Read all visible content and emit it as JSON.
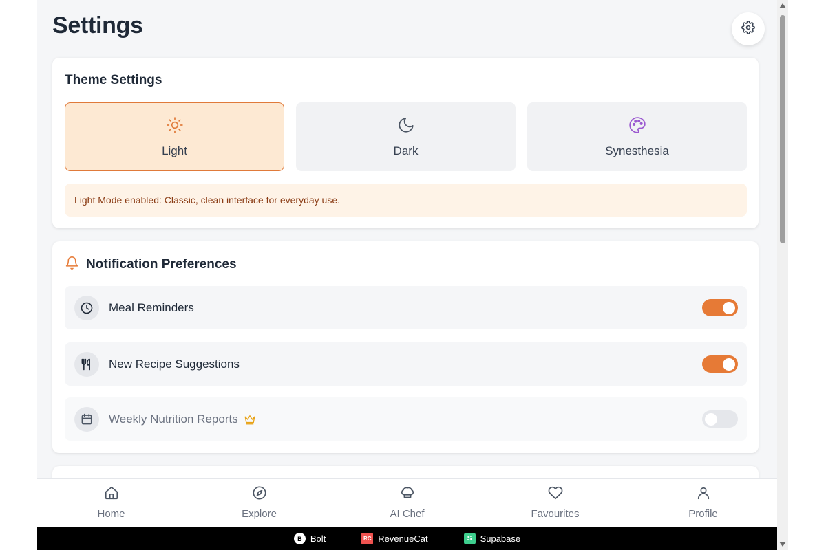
{
  "page": {
    "title": "Settings"
  },
  "header": {
    "settings_icon": "gear-icon"
  },
  "theme": {
    "heading": "Theme Settings",
    "options": [
      {
        "label": "Light",
        "icon": "sun-icon",
        "selected": true,
        "color": "#e07a3a"
      },
      {
        "label": "Dark",
        "icon": "moon-icon",
        "selected": false,
        "color": "#4b5563"
      },
      {
        "label": "Synesthesia",
        "icon": "palette-icon",
        "selected": false,
        "color": "#9b59d0"
      }
    ],
    "info": "Light Mode enabled: Classic, clean interface for everyday use."
  },
  "notifications": {
    "heading": "Notification Preferences",
    "heading_icon": "bell-icon",
    "items": [
      {
        "label": "Meal Reminders",
        "icon": "clock-icon",
        "enabled": true,
        "premium": false
      },
      {
        "label": "New Recipe Suggestions",
        "icon": "utensils-icon",
        "enabled": true,
        "premium": false
      },
      {
        "label": "Weekly Nutrition Reports",
        "icon": "calendar-icon",
        "enabled": false,
        "premium": true,
        "premium_icon": "crown-icon"
      }
    ]
  },
  "nav": {
    "items": [
      {
        "label": "Home",
        "icon": "home-icon"
      },
      {
        "label": "Explore",
        "icon": "compass-icon"
      },
      {
        "label": "AI Chef",
        "icon": "chef-hat-icon"
      },
      {
        "label": "Favourites",
        "icon": "heart-icon"
      },
      {
        "label": "Profile",
        "icon": "user-icon"
      }
    ]
  },
  "footer": {
    "items": [
      {
        "label": "Bolt",
        "logo": "B"
      },
      {
        "label": "RevenueCat",
        "logo": "RC"
      },
      {
        "label": "Supabase",
        "logo": "S"
      }
    ]
  },
  "colors": {
    "accent": "#e67a36",
    "selected_bg": "#fde9d3",
    "info_bg": "#fef3e7",
    "info_text": "#8a3b14",
    "toggle_off": "#e5e7eb"
  }
}
